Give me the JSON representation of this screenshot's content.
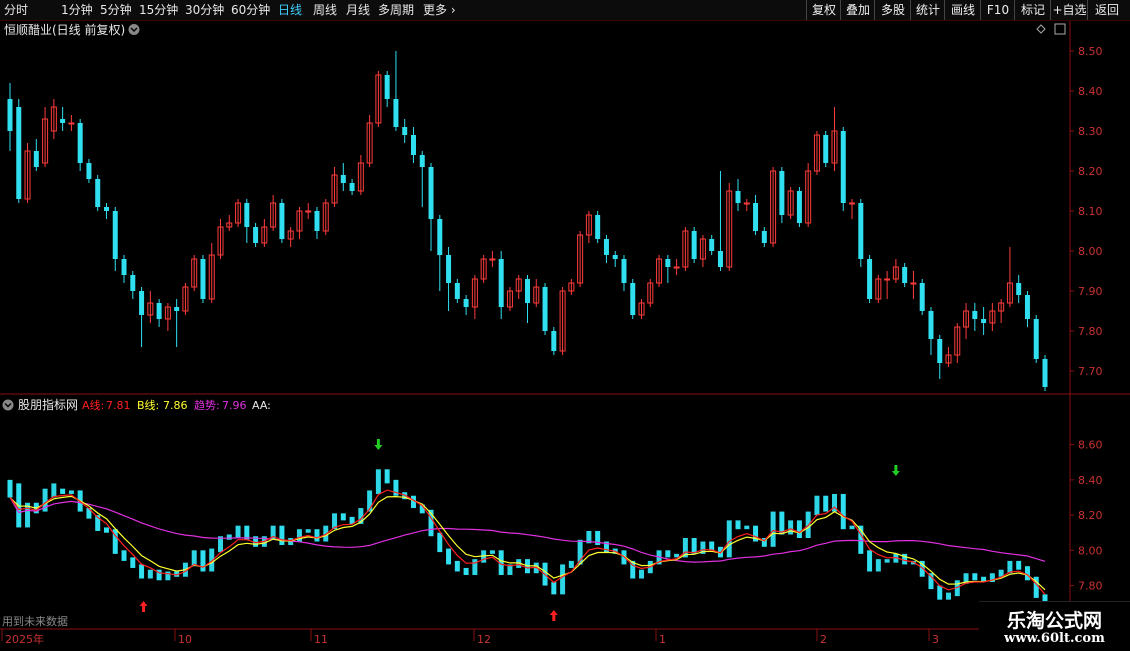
{
  "toolbar": {
    "left_items": [
      "分时",
      "1分钟",
      "5分钟",
      "15分钟",
      "30分钟",
      "60分钟",
      "日线",
      "周线",
      "月线",
      "多周期",
      "更多"
    ],
    "active": "日线",
    "right_items": [
      "复权",
      "叠加",
      "多股",
      "统计",
      "画线",
      "F10",
      "标记",
      "+自选",
      "返回"
    ]
  },
  "main_panel": {
    "title": "恒顺醋业(日线 前复权)",
    "y_ticks": [
      "8.50",
      "8.40",
      "8.30",
      "8.20",
      "8.10",
      "8.00",
      "7.90",
      "7.80",
      "7.70"
    ]
  },
  "indicator_panel": {
    "name": "股朋指标网",
    "a_label": "A线:",
    "a_value": "7.81",
    "b_label": "B线:",
    "b_value": "7.86",
    "trend_label": "趋势:",
    "trend_value": "7.96",
    "aa_label": "AA:",
    "y_ticks": [
      "8.60",
      "8.40",
      "8.20",
      "8.00",
      "7.80"
    ],
    "note": "用到未来数据"
  },
  "x_axis": {
    "labels": [
      "2025年",
      "10",
      "11",
      "12",
      "1",
      "2",
      "3"
    ]
  },
  "watermark": {
    "line1": "乐淘公式网",
    "line2": "www.60lt.com"
  },
  "colors": {
    "up": "#ff3c3c",
    "down": "#30e0f0",
    "line_a": "#ff2020",
    "line_b": "#ffff30",
    "trend": "#e030e0",
    "axis": "#8a1010"
  },
  "chart_data": {
    "type": "candlestick",
    "main_ylim": [
      7.65,
      8.55
    ],
    "indicator_ylim": [
      7.65,
      8.7
    ],
    "candles": [
      [
        8.38,
        8.3,
        8.42,
        8.25
      ],
      [
        8.36,
        8.13,
        8.38,
        8.12
      ],
      [
        8.13,
        8.25,
        8.27,
        8.12
      ],
      [
        8.25,
        8.21,
        8.28,
        8.2
      ],
      [
        8.22,
        8.33,
        8.36,
        8.21
      ],
      [
        8.3,
        8.36,
        8.38,
        8.28
      ],
      [
        8.33,
        8.32,
        8.36,
        8.3
      ],
      [
        8.32,
        8.32,
        8.34,
        8.3
      ],
      [
        8.32,
        8.22,
        8.33,
        8.2
      ],
      [
        8.22,
        8.18,
        8.23,
        8.17
      ],
      [
        8.18,
        8.11,
        8.19,
        8.1
      ],
      [
        8.11,
        8.1,
        8.12,
        8.08
      ],
      [
        8.1,
        7.98,
        8.11,
        7.95
      ],
      [
        7.98,
        7.94,
        7.99,
        7.92
      ],
      [
        7.94,
        7.9,
        7.95,
        7.88
      ],
      [
        7.9,
        7.84,
        7.91,
        7.76
      ],
      [
        7.84,
        7.87,
        7.9,
        7.82
      ],
      [
        7.87,
        7.83,
        7.88,
        7.81
      ],
      [
        7.83,
        7.86,
        7.87,
        7.8
      ],
      [
        7.86,
        7.85,
        7.88,
        7.76
      ],
      [
        7.85,
        7.91,
        7.92,
        7.84
      ],
      [
        7.91,
        7.98,
        7.99,
        7.9
      ],
      [
        7.98,
        7.88,
        7.99,
        7.87
      ],
      [
        7.88,
        7.99,
        8.02,
        7.87
      ],
      [
        7.99,
        8.06,
        8.08,
        7.98
      ],
      [
        8.06,
        8.07,
        8.09,
        8.05
      ],
      [
        8.07,
        8.12,
        8.13,
        8.06
      ],
      [
        8.12,
        8.06,
        8.13,
        8.02
      ],
      [
        8.06,
        8.02,
        8.07,
        8.01
      ],
      [
        8.02,
        8.06,
        8.08,
        8.01
      ],
      [
        8.06,
        8.12,
        8.14,
        8.05
      ],
      [
        8.12,
        8.03,
        8.13,
        8.02
      ],
      [
        8.03,
        8.05,
        8.06,
        8.01
      ],
      [
        8.05,
        8.1,
        8.11,
        8.03
      ],
      [
        8.1,
        8.1,
        8.12,
        8.08
      ],
      [
        8.1,
        8.05,
        8.11,
        8.03
      ],
      [
        8.05,
        8.12,
        8.13,
        8.04
      ],
      [
        8.12,
        8.19,
        8.21,
        8.11
      ],
      [
        8.19,
        8.17,
        8.22,
        8.15
      ],
      [
        8.17,
        8.15,
        8.18,
        8.14
      ],
      [
        8.15,
        8.22,
        8.24,
        8.14
      ],
      [
        8.22,
        8.32,
        8.34,
        8.21
      ],
      [
        8.32,
        8.44,
        8.45,
        8.31
      ],
      [
        8.44,
        8.38,
        8.45,
        8.36
      ],
      [
        8.38,
        8.31,
        8.5,
        8.3
      ],
      [
        8.31,
        8.29,
        8.33,
        8.27
      ],
      [
        8.29,
        8.24,
        8.31,
        8.22
      ],
      [
        8.24,
        8.21,
        8.25,
        8.11
      ],
      [
        8.21,
        8.08,
        8.22,
        8.0
      ],
      [
        8.08,
        7.99,
        8.09,
        7.9
      ],
      [
        7.99,
        7.92,
        8.01,
        7.85
      ],
      [
        7.92,
        7.88,
        7.93,
        7.87
      ],
      [
        7.88,
        7.86,
        7.89,
        7.84
      ],
      [
        7.86,
        7.93,
        7.94,
        7.83
      ],
      [
        7.93,
        7.98,
        7.99,
        7.92
      ],
      [
        7.98,
        7.98,
        8.0,
        7.96
      ],
      [
        7.98,
        7.86,
        8.0,
        7.83
      ],
      [
        7.86,
        7.9,
        7.91,
        7.85
      ],
      [
        7.9,
        7.93,
        7.94,
        7.88
      ],
      [
        7.93,
        7.87,
        7.94,
        7.82
      ],
      [
        7.87,
        7.91,
        7.93,
        7.86
      ],
      [
        7.91,
        7.8,
        7.92,
        7.79
      ],
      [
        7.8,
        7.75,
        7.81,
        7.74
      ],
      [
        7.75,
        7.9,
        7.91,
        7.74
      ],
      [
        7.9,
        7.92,
        7.93,
        7.89
      ],
      [
        7.92,
        8.04,
        8.05,
        7.91
      ],
      [
        8.04,
        8.09,
        8.1,
        8.02
      ],
      [
        8.09,
        8.03,
        8.1,
        8.02
      ],
      [
        8.03,
        7.99,
        8.04,
        7.97
      ],
      [
        7.99,
        7.98,
        8.0,
        7.96
      ],
      [
        7.98,
        7.92,
        7.99,
        7.9
      ],
      [
        7.92,
        7.84,
        7.93,
        7.83
      ],
      [
        7.84,
        7.87,
        7.88,
        7.83
      ],
      [
        7.87,
        7.92,
        7.93,
        7.86
      ],
      [
        7.92,
        7.98,
        7.99,
        7.91
      ],
      [
        7.98,
        7.96,
        7.99,
        7.92
      ],
      [
        7.96,
        7.96,
        7.98,
        7.94
      ],
      [
        7.96,
        8.05,
        8.06,
        7.95
      ],
      [
        8.05,
        7.98,
        8.06,
        7.97
      ],
      [
        7.98,
        8.03,
        8.04,
        7.96
      ],
      [
        8.03,
        8.0,
        8.04,
        7.99
      ],
      [
        8.0,
        7.96,
        8.2,
        7.95
      ],
      [
        7.96,
        8.15,
        8.17,
        7.95
      ],
      [
        8.15,
        8.12,
        8.18,
        8.1
      ],
      [
        8.12,
        8.12,
        8.13,
        8.1
      ],
      [
        8.12,
        8.05,
        8.14,
        8.04
      ],
      [
        8.05,
        8.02,
        8.06,
        8.01
      ],
      [
        8.02,
        8.2,
        8.21,
        8.01
      ],
      [
        8.2,
        8.09,
        8.21,
        8.07
      ],
      [
        8.09,
        8.15,
        8.16,
        8.08
      ],
      [
        8.15,
        8.07,
        8.16,
        8.06
      ],
      [
        8.07,
        8.2,
        8.22,
        8.06
      ],
      [
        8.2,
        8.29,
        8.3,
        8.19
      ],
      [
        8.29,
        8.22,
        8.3,
        8.21
      ],
      [
        8.22,
        8.3,
        8.36,
        8.2
      ],
      [
        8.3,
        8.12,
        8.31,
        8.1
      ],
      [
        8.12,
        8.12,
        8.13,
        8.08
      ],
      [
        8.12,
        7.98,
        8.13,
        7.96
      ],
      [
        7.98,
        7.88,
        7.99,
        7.87
      ],
      [
        7.88,
        7.93,
        7.94,
        7.87
      ],
      [
        7.93,
        7.93,
        7.95,
        7.88
      ],
      [
        7.93,
        7.96,
        7.98,
        7.92
      ],
      [
        7.96,
        7.92,
        7.97,
        7.91
      ],
      [
        7.92,
        7.92,
        7.95,
        7.88
      ],
      [
        7.92,
        7.85,
        7.93,
        7.84
      ],
      [
        7.85,
        7.78,
        7.86,
        7.74
      ],
      [
        7.78,
        7.72,
        7.79,
        7.68
      ],
      [
        7.72,
        7.74,
        7.76,
        7.71
      ],
      [
        7.74,
        7.81,
        7.82,
        7.72
      ],
      [
        7.81,
        7.85,
        7.87,
        7.78
      ],
      [
        7.85,
        7.83,
        7.87,
        7.8
      ],
      [
        7.83,
        7.82,
        7.86,
        7.79
      ],
      [
        7.82,
        7.85,
        7.87,
        7.8
      ],
      [
        7.85,
        7.87,
        7.88,
        7.82
      ],
      [
        7.87,
        7.92,
        8.01,
        7.86
      ],
      [
        7.92,
        7.89,
        7.94,
        7.87
      ],
      [
        7.89,
        7.83,
        7.9,
        7.81
      ],
      [
        7.83,
        7.73,
        7.84,
        7.72
      ],
      [
        7.73,
        7.66,
        7.74,
        7.65
      ]
    ],
    "volume_pattern": "down"
  }
}
